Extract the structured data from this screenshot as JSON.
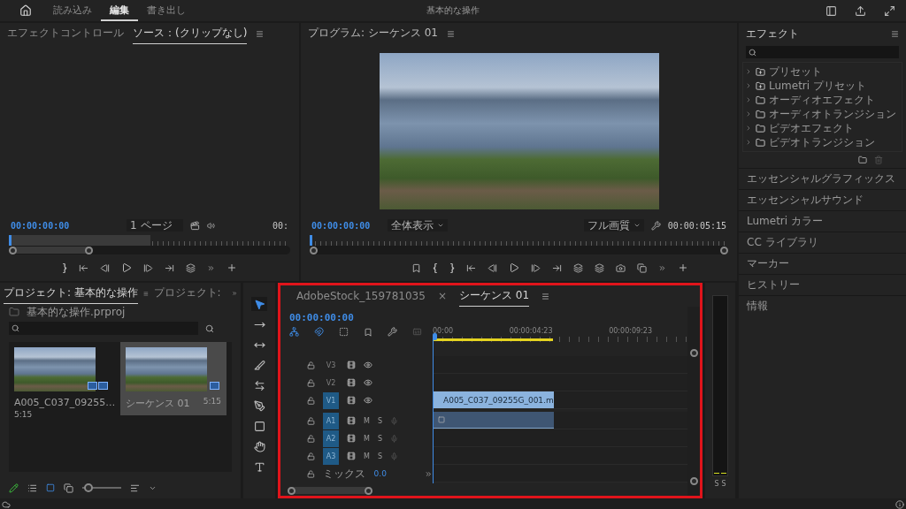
{
  "header": {
    "tabs": [
      {
        "label": "読み込み",
        "selected": false
      },
      {
        "label": "編集",
        "selected": true
      },
      {
        "label": "書き出し",
        "selected": false
      }
    ],
    "title": "基本的な操作"
  },
  "source_monitor": {
    "tabs": [
      {
        "label": "エフェクトコントロール",
        "selected": false
      },
      {
        "label": "ソース：(クリップなし)",
        "selected": true
      }
    ],
    "timecode": "00:00:00:00",
    "page_select": "1 ページ",
    "end_timecode": "00:"
  },
  "program_monitor": {
    "title": "プログラム: シーケンス 01",
    "timecode": "00:00:00:00",
    "fit_select": "全体表示",
    "quality_select": "フル画質",
    "duration": "00:00:05:15"
  },
  "effects": {
    "title": "エフェクト",
    "folders": [
      {
        "label": "プリセット",
        "kind": "preset"
      },
      {
        "label": "Lumetri プリセット",
        "kind": "preset"
      },
      {
        "label": "オーディオエフェクト",
        "kind": "folder"
      },
      {
        "label": "オーディオトランジション",
        "kind": "folder"
      },
      {
        "label": "ビデオエフェクト",
        "kind": "folder"
      },
      {
        "label": "ビデオトランジション",
        "kind": "folder"
      }
    ],
    "sections": [
      "エッセンシャルグラフィックス",
      "エッセンシャルサウンド",
      "Lumetri カラー",
      "CC ライブラリ",
      "マーカー",
      "ヒストリー",
      "情報"
    ]
  },
  "project": {
    "tabs": [
      {
        "label": "プロジェクト: 基本的な操作",
        "selected": true
      },
      {
        "label": "プロジェクト:",
        "selected": false
      }
    ],
    "file": "基本的な操作.prproj",
    "zoom_slider": {
      "level": 0.05
    },
    "items": [
      {
        "name": "A005_C037_09255…",
        "duration": "5:15",
        "kind": "clip",
        "selected": false
      },
      {
        "name": "シーケンス 01",
        "duration": "5:15",
        "kind": "sequence",
        "selected": true
      }
    ]
  },
  "tools": [
    {
      "kind": "select",
      "selected": true
    },
    {
      "kind": "track-select",
      "selected": false
    },
    {
      "kind": "ripple",
      "selected": false
    },
    {
      "kind": "razor",
      "selected": false
    },
    {
      "kind": "slip",
      "selected": false
    },
    {
      "kind": "pen",
      "selected": false
    },
    {
      "kind": "rectangle",
      "selected": false
    },
    {
      "kind": "hand",
      "selected": false
    },
    {
      "kind": "type",
      "selected": false
    }
  ],
  "timeline": {
    "tabs": [
      {
        "label": "AdobeStock_159781035",
        "selected": false
      },
      {
        "label": "シーケンス 01",
        "selected": true,
        "close": "×"
      }
    ],
    "timecode": "00:00:00:00",
    "ruler": [
      "00:00",
      "00:00:04:23",
      "00:00:09:23"
    ],
    "tracks": [
      {
        "name": "V3",
        "kind": "video",
        "targeted": false,
        "has_clip": false
      },
      {
        "name": "V2",
        "kind": "video",
        "targeted": false,
        "has_clip": false
      },
      {
        "name": "V1",
        "kind": "video",
        "targeted": true,
        "has_clip": true,
        "clip_label": "A005_C037_09255G_001.m"
      },
      {
        "name": "A1",
        "kind": "audio",
        "targeted": true,
        "has_clip": true,
        "mute": "M",
        "solo": "S"
      },
      {
        "name": "A2",
        "kind": "audio",
        "targeted": true,
        "has_clip": false,
        "mute": "M",
        "solo": "S"
      },
      {
        "name": "A3",
        "kind": "audio",
        "targeted": true,
        "has_clip": false,
        "mute": "M",
        "solo": "S"
      }
    ],
    "mix": {
      "label": "ミックス",
      "value": "0.0"
    }
  },
  "meter": {
    "labels": [
      "S",
      "S"
    ]
  }
}
